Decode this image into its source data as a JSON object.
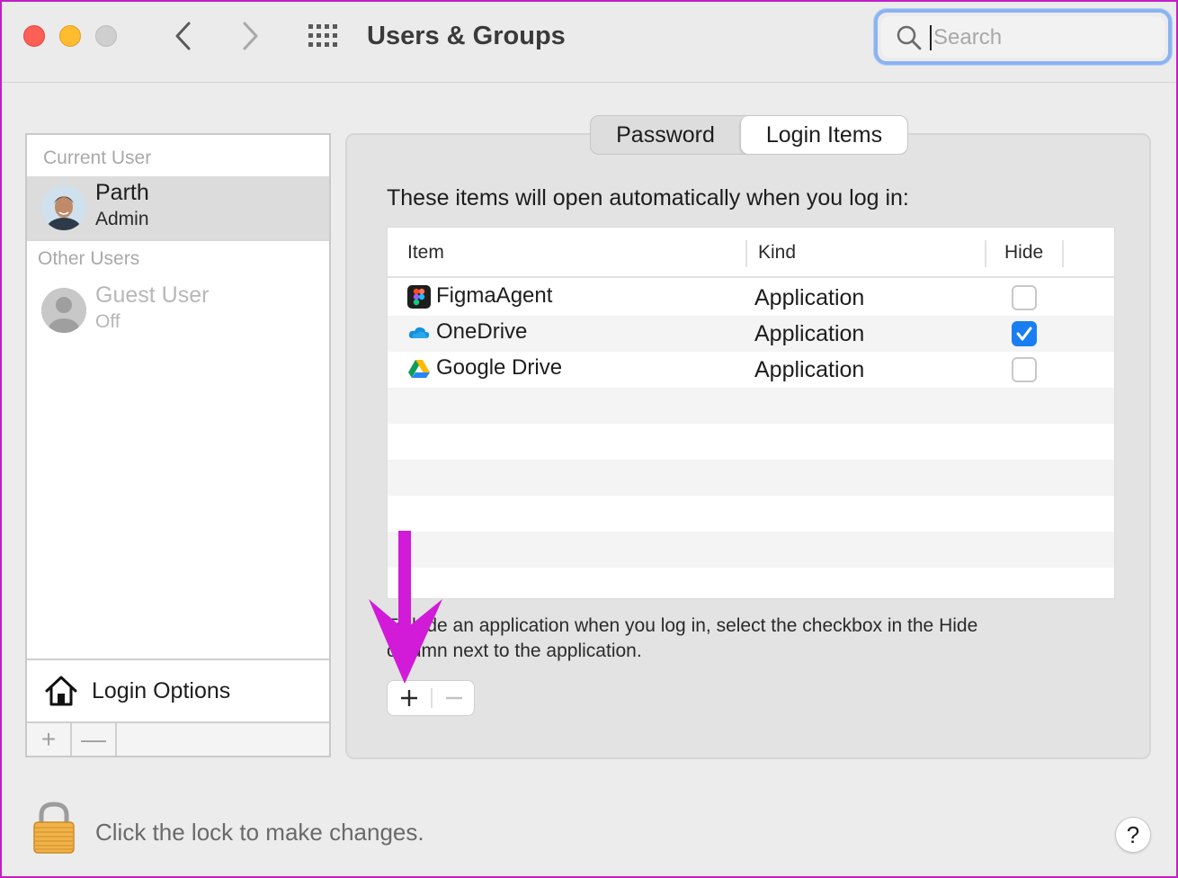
{
  "window": {
    "title": "Users & Groups"
  },
  "toolbar": {
    "search_placeholder": "Search",
    "back_icon": "chevron-left-icon",
    "forward_icon": "chevron-right-icon",
    "grid_icon": "grid-icon"
  },
  "sidebar": {
    "current_user_header": "Current User",
    "other_users_header": "Other Users",
    "current_user": {
      "name": "Parth",
      "role": "Admin"
    },
    "other_users": [
      {
        "name": "Guest User",
        "role": "Off"
      }
    ],
    "login_options_label": "Login Options",
    "add_label": "+",
    "remove_label": "—"
  },
  "tabs": [
    {
      "label": "Password",
      "active": false
    },
    {
      "label": "Login Items",
      "active": true
    }
  ],
  "login_items": {
    "intro": "These items will open automatically when you log in:",
    "columns": {
      "item": "Item",
      "kind": "Kind",
      "hide": "Hide"
    },
    "rows": [
      {
        "name": "FigmaAgent",
        "kind": "Application",
        "hide": false,
        "icon": "figma-icon"
      },
      {
        "name": "OneDrive",
        "kind": "Application",
        "hide": true,
        "icon": "onedrive-icon"
      },
      {
        "name": "Google Drive",
        "kind": "Application",
        "hide": false,
        "icon": "google-drive-icon"
      }
    ],
    "hint_line1": "To hide an application when you log in, select the checkbox in the Hide",
    "hint_line2": "column next to the application."
  },
  "footer": {
    "lock_text": "Click the lock to make changes.",
    "help_label": "?"
  },
  "colors": {
    "window_border": "#c21fc7",
    "annotation_arrow": "#d21ad9",
    "accent": "#1a7ef2"
  }
}
